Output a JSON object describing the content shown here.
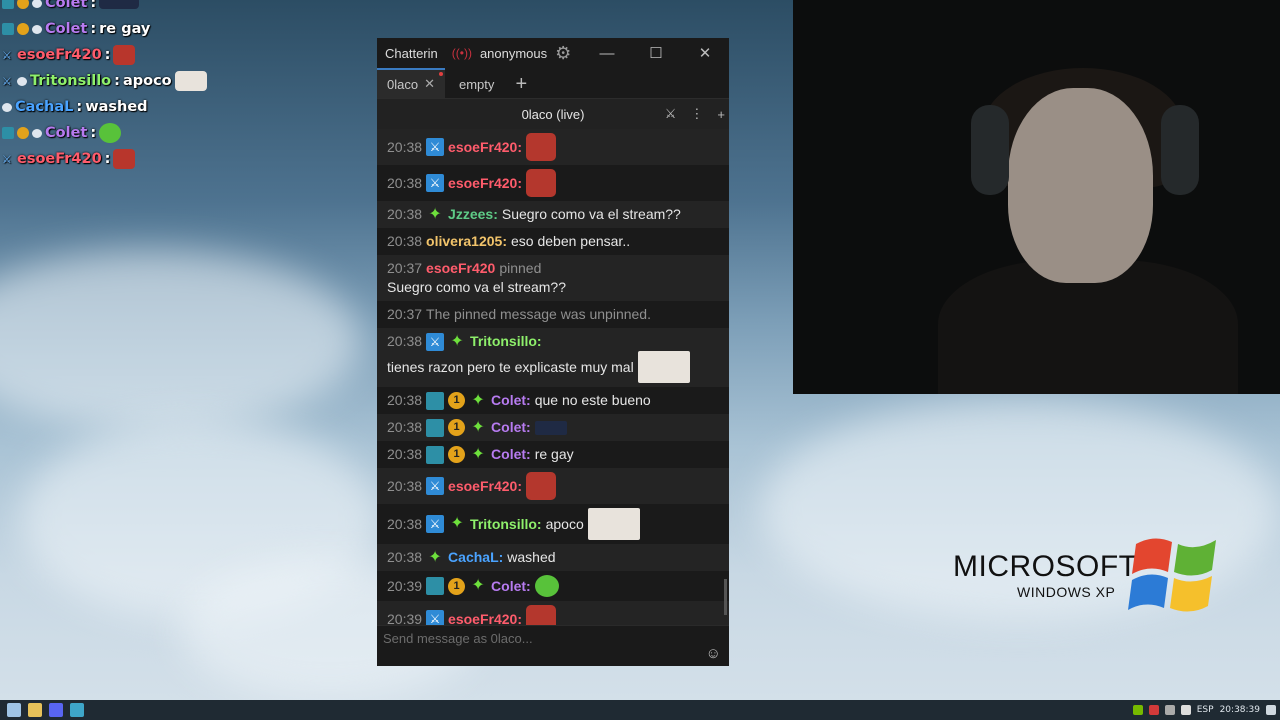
{
  "overlay_chat": [
    {
      "badges": [
        "grid",
        "coin",
        "pill"
      ],
      "name": "Colet",
      "name_color": "#b77bf0",
      "text": "",
      "emote": "car"
    },
    {
      "badges": [
        "grid",
        "coin",
        "pill"
      ],
      "name": "Colet",
      "name_color": "#b77bf0",
      "text": "re gay",
      "emote": ""
    },
    {
      "badges": [
        "sword"
      ],
      "name": "esoeFr420",
      "name_color": "#ff5c6c",
      "text": "",
      "emote": "face"
    },
    {
      "badges": [
        "sword",
        "pill"
      ],
      "name": "Tritonsillo",
      "name_color": "#8ef06b",
      "text": "apoco",
      "emote": "bro"
    },
    {
      "badges": [
        "pill"
      ],
      "name": "CachaL",
      "name_color": "#4aa3ff",
      "text": "washed",
      "emote": ""
    },
    {
      "badges": [
        "grid",
        "coin",
        "pill"
      ],
      "name": "Colet",
      "name_color": "#b77bf0",
      "text": "",
      "emote": "green"
    },
    {
      "badges": [
        "sword"
      ],
      "name": "esoeFr420",
      "name_color": "#ff5c6c",
      "text": "",
      "emote": "face"
    }
  ],
  "window": {
    "title": "Chatterin",
    "account": "anonymous",
    "tabs": [
      {
        "label": "0laco",
        "active": true
      },
      {
        "label": "empty",
        "active": false
      }
    ],
    "split_header": "0laco (live)",
    "input_placeholder": "Send message as 0laco..."
  },
  "messages": [
    {
      "ts": "20:38",
      "badges": [
        "mod"
      ],
      "name": "esoeFr420:",
      "color": "#ff5c6c",
      "text": "",
      "emote": "face",
      "alt": true
    },
    {
      "ts": "20:38",
      "badges": [
        "mod"
      ],
      "name": "esoeFr420:",
      "color": "#ff5c6c",
      "text": "",
      "emote": "face",
      "alt": false
    },
    {
      "ts": "20:38",
      "badges": [
        "vip"
      ],
      "name": "Jzzees:",
      "color": "#5ecc87",
      "text": "Suegro como va el stream??",
      "emote": "",
      "alt": true
    },
    {
      "ts": "20:38",
      "badges": [],
      "name": "olivera1205:",
      "color": "#f2c46b",
      "text": "eso deben pensar..",
      "emote": "",
      "alt": false
    },
    {
      "ts": "20:37",
      "badges": [],
      "name": "esoeFr420",
      "color": "#ff5c6c",
      "sys_mid": "pinned",
      "text": "Suegro como va el stream??",
      "emote": "",
      "alt": true
    },
    {
      "ts": "20:37",
      "badges": [],
      "name": "",
      "color": "",
      "sys": "The pinned message was unpinned.",
      "text": "",
      "emote": "",
      "alt": false
    },
    {
      "ts": "20:38",
      "badges": [
        "mod",
        "vip"
      ],
      "name": "Tritonsillo:",
      "color": "#8ef06b",
      "text": "tienes razon pero te explicaste muy mal",
      "emote": "bro",
      "alt": true
    },
    {
      "ts": "20:38",
      "badges": [
        "grid",
        "coin",
        "vip"
      ],
      "name": "Colet:",
      "color": "#b77bf0",
      "text": "que no este bueno",
      "emote": "",
      "alt": false
    },
    {
      "ts": "20:38",
      "badges": [
        "grid",
        "coin",
        "vip"
      ],
      "name": "Colet:",
      "color": "#b77bf0",
      "text": "",
      "emote": "car",
      "alt": true
    },
    {
      "ts": "20:38",
      "badges": [
        "grid",
        "coin",
        "vip"
      ],
      "name": "Colet:",
      "color": "#b77bf0",
      "text": "re gay",
      "emote": "",
      "alt": false
    },
    {
      "ts": "20:38",
      "badges": [
        "mod"
      ],
      "name": "esoeFr420:",
      "color": "#ff5c6c",
      "text": "",
      "emote": "face",
      "alt": true
    },
    {
      "ts": "20:38",
      "badges": [
        "mod",
        "vip"
      ],
      "name": "Tritonsillo:",
      "color": "#8ef06b",
      "text": "apoco",
      "emote": "bro",
      "alt": false
    },
    {
      "ts": "20:38",
      "badges": [
        "vip"
      ],
      "name": "CachaL:",
      "color": "#4aa3ff",
      "text": "washed",
      "emote": "",
      "alt": true
    },
    {
      "ts": "20:39",
      "badges": [
        "grid",
        "coin",
        "vip"
      ],
      "name": "Colet:",
      "color": "#b77bf0",
      "text": "",
      "emote": "green",
      "alt": false
    },
    {
      "ts": "20:39",
      "badges": [
        "mod"
      ],
      "name": "esoeFr420:",
      "color": "#ff5c6c",
      "text": "",
      "emote": "face",
      "alt": true
    }
  ],
  "desktop": {
    "logo_line1": "MICROSOFT",
    "logo_line2": "WINDOWS XP"
  },
  "taskbar": {
    "language": "ESP",
    "clock": "20:38:39"
  }
}
